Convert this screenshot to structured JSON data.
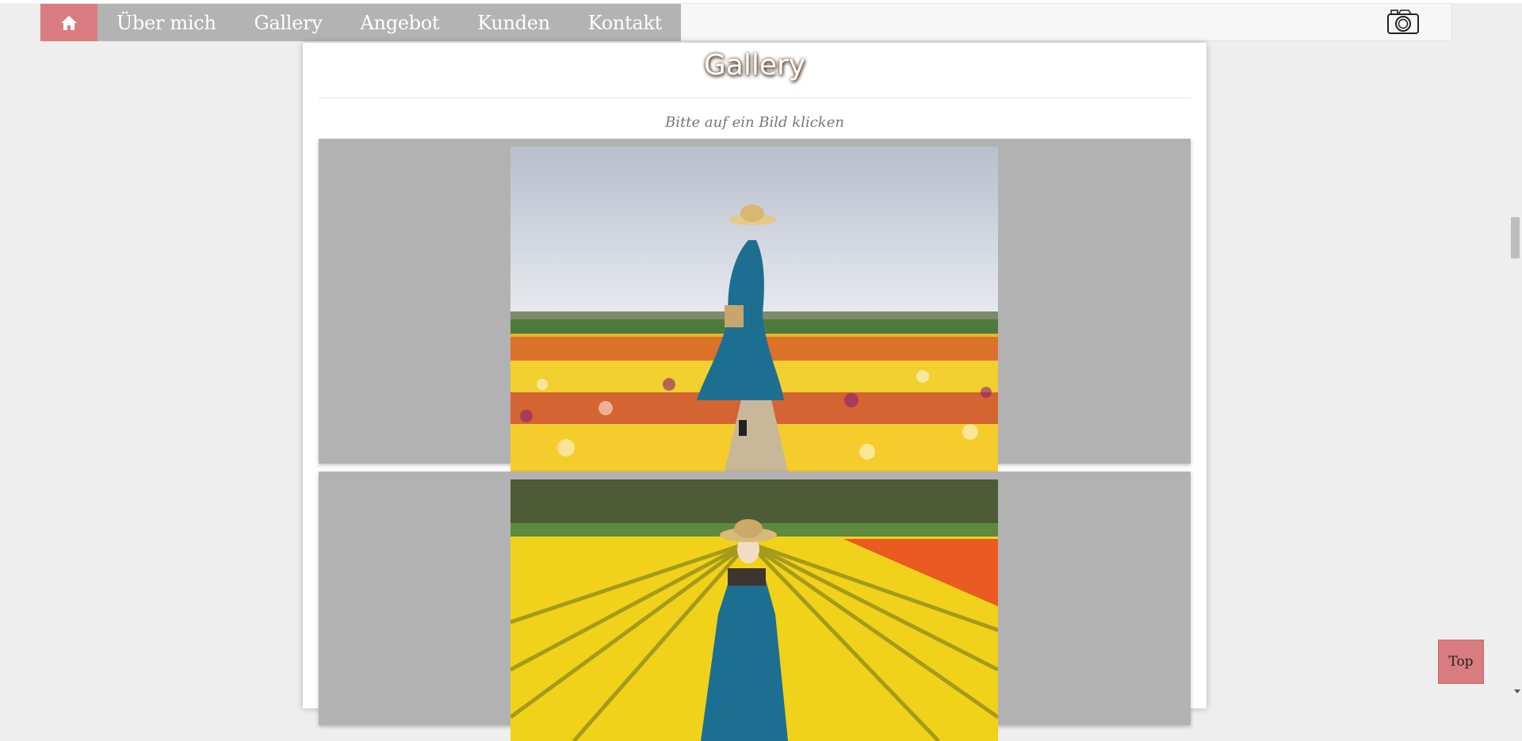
{
  "nav": {
    "home_icon": "home-icon",
    "items": [
      {
        "label": "Über mich"
      },
      {
        "label": "Gallery"
      },
      {
        "label": "Angebot"
      },
      {
        "label": "Kunden"
      },
      {
        "label": "Kontakt"
      }
    ],
    "camera_icon": "camera-icon"
  },
  "page": {
    "title": "Gallery",
    "hint": "Bitte auf ein Bild klicken"
  },
  "gallery": {
    "photos": [
      "photo-tulip-field-back",
      "photo-tulip-field-front"
    ]
  },
  "back_to_top": {
    "label": "Top"
  },
  "colors": {
    "accent": "#d97c7f",
    "nav_bg": "#b3b3b3",
    "gallery_bg": "#b2b2b2"
  }
}
